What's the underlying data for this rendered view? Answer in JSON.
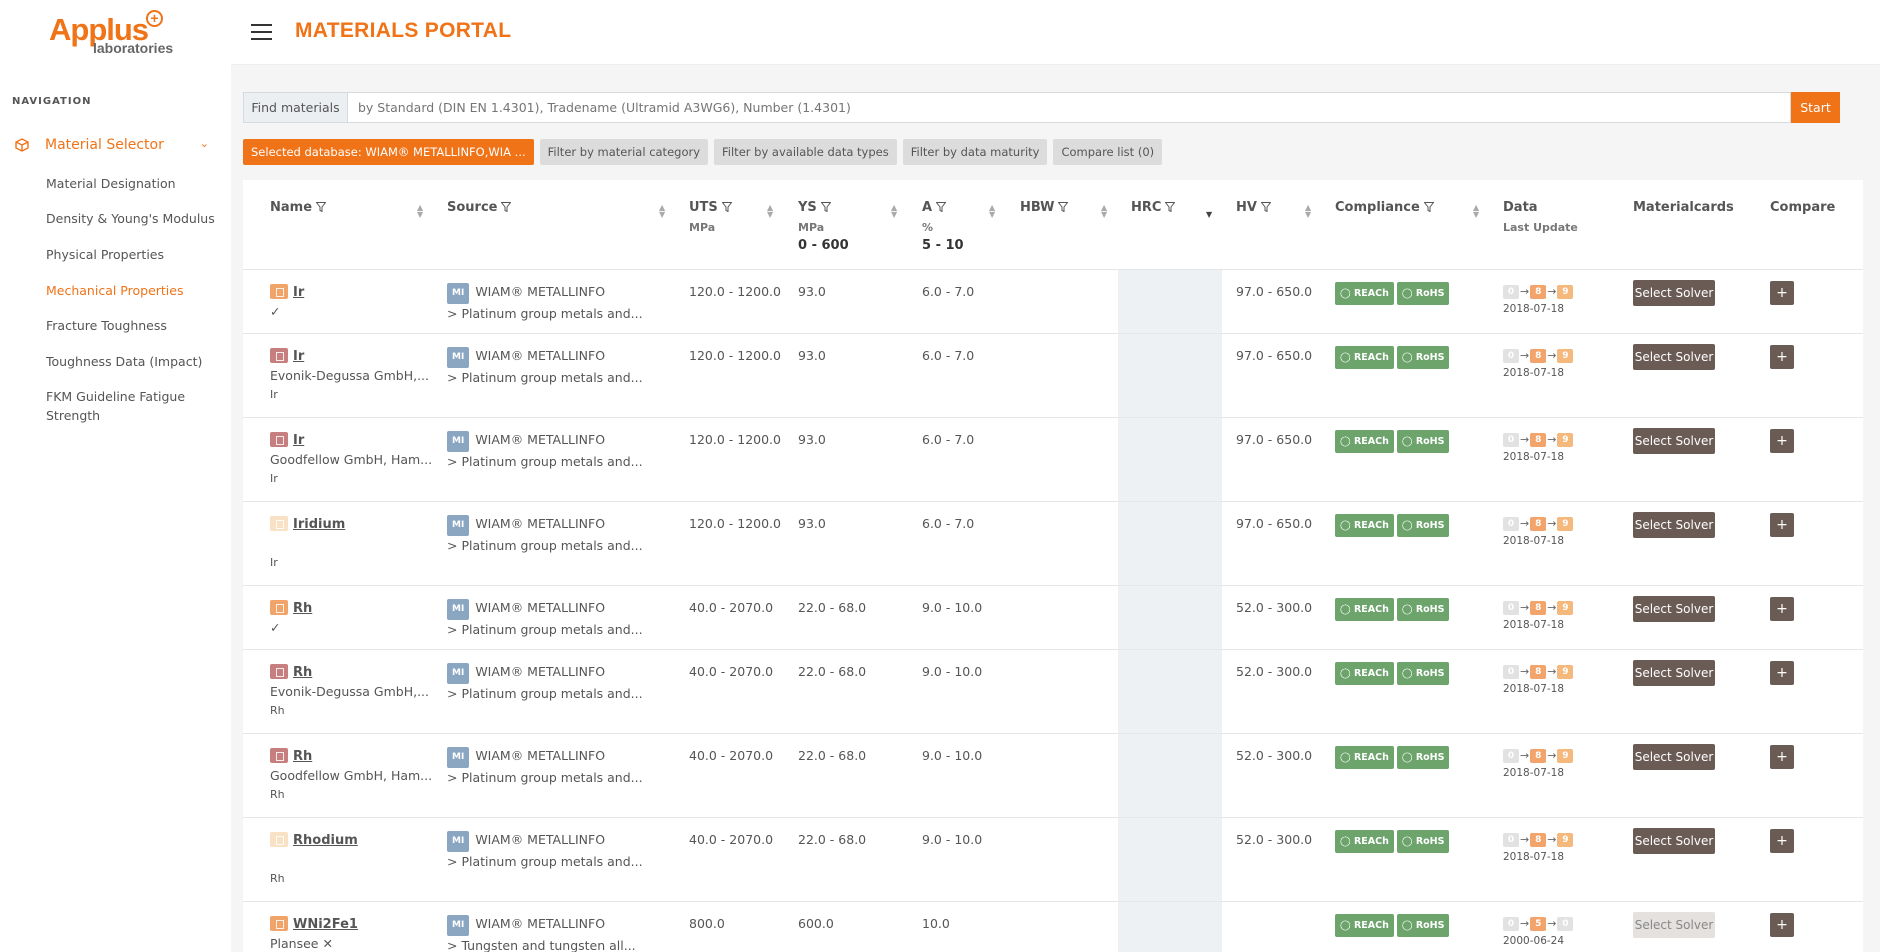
{
  "logo": {
    "main": "Applus",
    "sub": "laboratories",
    "plus": "+"
  },
  "navigation": {
    "heading": "NAVIGATION",
    "section": "Material Selector",
    "items": [
      {
        "label": "Material Designation",
        "active": false
      },
      {
        "label": "Density & Young's Modulus",
        "active": false
      },
      {
        "label": "Physical Properties",
        "active": false
      },
      {
        "label": "Mechanical Properties",
        "active": true
      },
      {
        "label": "Fracture Toughness",
        "active": false
      },
      {
        "label": "Toughness Data (Impact)",
        "active": false
      },
      {
        "label": "FKM Guideline Fatigue Strength",
        "active": false
      }
    ]
  },
  "header": {
    "title": "MATERIALS PORTAL"
  },
  "search": {
    "label": "Find materials",
    "placeholder": "by Standard (DIN EN 1.4301), Tradename (Ultramid A3WG6), Number (1.4301)",
    "button": "Start"
  },
  "filters": {
    "database": "Selected database: WIAM® METALLINFO,WIA ...",
    "category": "Filter by material category",
    "data_types": "Filter by available data types",
    "maturity": "Filter by data maturity",
    "compare": "Compare list (0)"
  },
  "table": {
    "headers": {
      "name": "Name",
      "source": "Source",
      "uts": "UTS",
      "uts_unit": "MPa",
      "ys": "YS",
      "ys_unit": "MPa",
      "ys_range": "0 - 600",
      "a": "A",
      "a_unit": "%",
      "a_range": "5 - 10",
      "hbw": "HBW",
      "hrc": "HRC",
      "hv": "HV",
      "compliance": "Compliance",
      "data": "Data",
      "data_sub": "Last Update",
      "materialcards": "Materialcards",
      "compare": "Compare"
    },
    "source_name": "WIAM® METALLINFO",
    "source_badge": "MI",
    "reach": "REACh",
    "rohs": "RoHS",
    "solver": "Select Solver",
    "plus": "+",
    "rows": [
      {
        "icon": "#f0a46a",
        "name": "Ir",
        "line2": "✓",
        "line3": "",
        "group": "> Platinum group metals and...",
        "uts": "120.0 - 1200.0",
        "ys": "93.0",
        "a": "6.0 - 7.0",
        "hv": "97.0 - 650.0",
        "compliance": true,
        "m1": "0",
        "m2": "8",
        "m3": "9",
        "date": "2018-07-18",
        "solver_disabled": false
      },
      {
        "icon": "#c77e7e",
        "name": "Ir",
        "line2": "Evonik-Degussa GmbH,...",
        "line3": "Ir",
        "group": "> Platinum group metals and...",
        "uts": "120.0 - 1200.0",
        "ys": "93.0",
        "a": "6.0 - 7.0",
        "hv": "97.0 - 650.0",
        "compliance": true,
        "m1": "0",
        "m2": "8",
        "m3": "9",
        "date": "2018-07-18",
        "solver_disabled": false
      },
      {
        "icon": "#c77e7e",
        "name": "Ir",
        "line2": "Goodfellow GmbH, Ham...",
        "line3": "Ir",
        "group": "> Platinum group metals and...",
        "uts": "120.0 - 1200.0",
        "ys": "93.0",
        "a": "6.0 - 7.0",
        "hv": "97.0 - 650.0",
        "compliance": true,
        "m1": "0",
        "m2": "8",
        "m3": "9",
        "date": "2018-07-18",
        "solver_disabled": false
      },
      {
        "icon": "#f8e1c5",
        "name": "Iridium",
        "line2": "",
        "line3": "Ir",
        "group": "> Platinum group metals and...",
        "uts": "120.0 - 1200.0",
        "ys": "93.0",
        "a": "6.0 - 7.0",
        "hv": "97.0 - 650.0",
        "compliance": true,
        "m1": "0",
        "m2": "8",
        "m3": "9",
        "date": "2018-07-18",
        "solver_disabled": false
      },
      {
        "icon": "#f0a46a",
        "name": "Rh",
        "line2": "✓",
        "line3": "",
        "group": "> Platinum group metals and...",
        "uts": "40.0 - 2070.0",
        "ys": "22.0 - 68.0",
        "a": "9.0 - 10.0",
        "hv": "52.0 - 300.0",
        "compliance": true,
        "m1": "0",
        "m2": "8",
        "m3": "9",
        "date": "2018-07-18",
        "solver_disabled": false
      },
      {
        "icon": "#c77e7e",
        "name": "Rh",
        "line2": "Evonik-Degussa GmbH,...",
        "line3": "Rh",
        "group": "> Platinum group metals and...",
        "uts": "40.0 - 2070.0",
        "ys": "22.0 - 68.0",
        "a": "9.0 - 10.0",
        "hv": "52.0 - 300.0",
        "compliance": true,
        "m1": "0",
        "m2": "8",
        "m3": "9",
        "date": "2018-07-18",
        "solver_disabled": false
      },
      {
        "icon": "#c77e7e",
        "name": "Rh",
        "line2": "Goodfellow GmbH, Ham...",
        "line3": "Rh",
        "group": "> Platinum group metals and...",
        "uts": "40.0 - 2070.0",
        "ys": "22.0 - 68.0",
        "a": "9.0 - 10.0",
        "hv": "52.0 - 300.0",
        "compliance": true,
        "m1": "0",
        "m2": "8",
        "m3": "9",
        "date": "2018-07-18",
        "solver_disabled": false
      },
      {
        "icon": "#f8e1c5",
        "name": "Rhodium",
        "line2": "",
        "line3": "Rh",
        "group": "> Platinum group metals and...",
        "uts": "40.0 - 2070.0",
        "ys": "22.0 - 68.0",
        "a": "9.0 - 10.0",
        "hv": "52.0 - 300.0",
        "compliance": true,
        "m1": "0",
        "m2": "8",
        "m3": "9",
        "date": "2018-07-18",
        "solver_disabled": false
      },
      {
        "icon": "#f0a46a",
        "name": "WNi2Fe1",
        "line2": "Plansee ✕",
        "line3": "",
        "group": "> Tungsten and tungsten all...",
        "uts": "800.0",
        "ys": "600.0",
        "a": "10.0",
        "hv": "",
        "compliance": true,
        "m1": "0",
        "m2": "5",
        "m3": "0",
        "date": "2000-06-24",
        "solver_disabled": true
      }
    ]
  }
}
